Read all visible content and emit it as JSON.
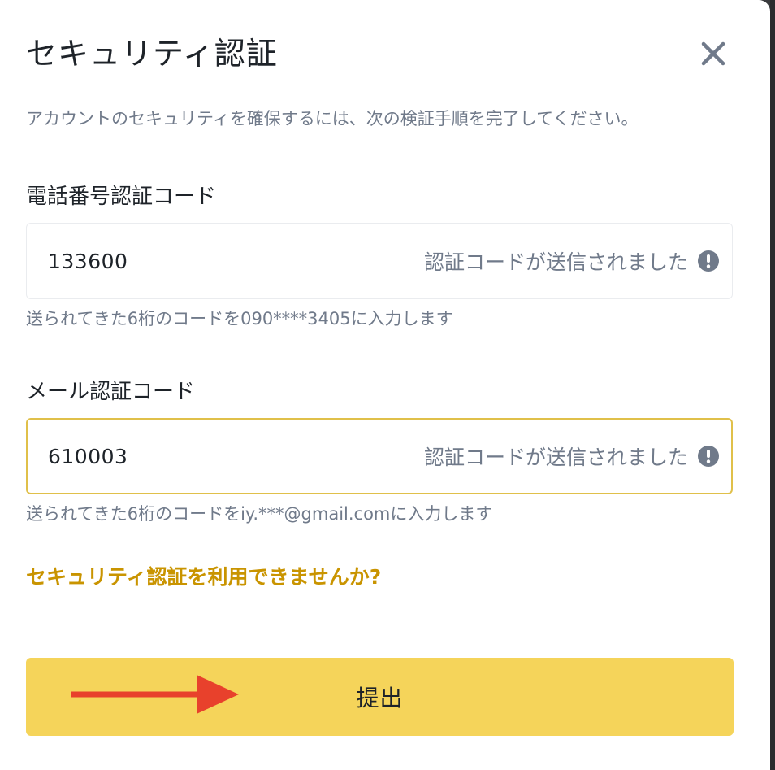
{
  "dialog": {
    "title": "セキュリティ認証",
    "subtitle": "アカウントのセキュリティを確保するには、次の検証手順を完了してください。"
  },
  "phone_field": {
    "label": "電話番号認証コード",
    "value": "133600",
    "status": "認証コードが送信されました",
    "help": "送られてきた6桁のコードを090****3405に入力します"
  },
  "email_field": {
    "label": "メール認証コード",
    "value": "610003",
    "status": "認証コードが送信されました",
    "help": "送られてきた6桁のコードをiy.***@gmail.comに入力します"
  },
  "unavailable_link": "セキュリティ認証を利用できませんか?",
  "submit_label": "提出",
  "colors": {
    "accent_gold": "#c99400",
    "button_yellow": "#f5d45a",
    "focus_border": "#e0c04a",
    "annotation_arrow": "#e8412c"
  },
  "icons": {
    "close": "close-icon",
    "status": "exclamation-circle-icon",
    "annotation": "red-arrow-icon"
  }
}
